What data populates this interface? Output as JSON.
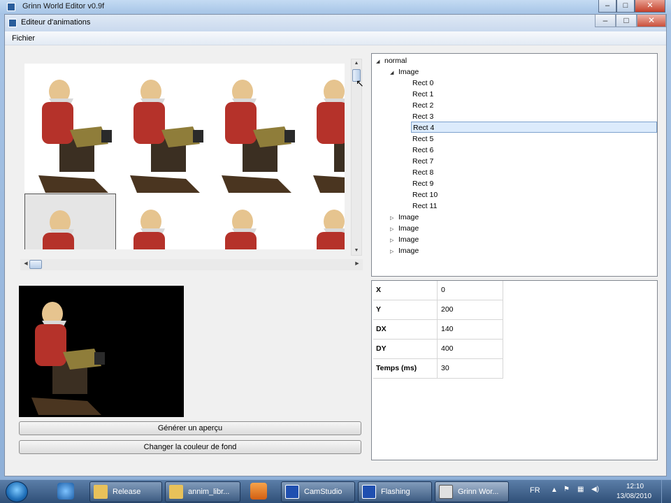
{
  "outer_window": {
    "title": "Grinn World Editor v0.9f"
  },
  "inner_window": {
    "title": "Editeur d'animations"
  },
  "caption_buttons": {
    "minimize": "–",
    "maximize": "□",
    "close": "✕"
  },
  "menu": {
    "items": [
      "Fichier"
    ]
  },
  "tree": {
    "root": "normal",
    "expanded_image": "Image",
    "rects": [
      "Rect 0",
      "Rect 1",
      "Rect 2",
      "Rect 3",
      "Rect 4",
      "Rect 5",
      "Rect 6",
      "Rect 7",
      "Rect 8",
      "Rect 9",
      "Rect 10",
      "Rect 11"
    ],
    "selected": "Rect 4",
    "collapsed_images": [
      "Image",
      "Image",
      "Image",
      "Image"
    ]
  },
  "properties": [
    {
      "key": "X",
      "value": "0"
    },
    {
      "key": "Y",
      "value": "200"
    },
    {
      "key": "DX",
      "value": "140"
    },
    {
      "key": "DY",
      "value": "400"
    },
    {
      "key": "Temps (ms)",
      "value": "30"
    }
  ],
  "buttons": {
    "generate_preview": "Générer un aperçu",
    "change_bg": "Changer la couleur de fond"
  },
  "taskbar": {
    "items": [
      {
        "label": "Release",
        "icon": "folder-icon"
      },
      {
        "label": "annim_libr...",
        "icon": "folder-icon"
      },
      {
        "label": "CamStudio",
        "icon": "camstudio-icon"
      },
      {
        "label": "Flashing",
        "icon": "app-icon"
      },
      {
        "label": "Grinn Wor...",
        "icon": "editor-icon"
      }
    ],
    "language": "FR",
    "time": "12:10",
    "date": "13/08/2010"
  },
  "colors": {
    "preview_bg": "#000000",
    "selection": "#dcebfc",
    "taskbar": "#2f4f77"
  }
}
